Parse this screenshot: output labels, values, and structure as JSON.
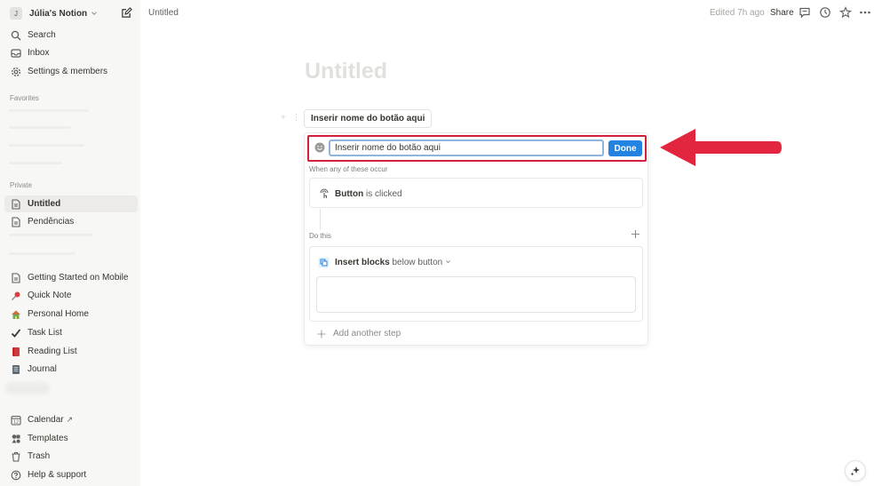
{
  "workspace": {
    "avatar_letter": "J",
    "name": "Júlia's Notion"
  },
  "sidebar": {
    "top_items": [
      {
        "label": "Search",
        "icon": "search-icon"
      },
      {
        "label": "Inbox",
        "icon": "inbox-icon"
      },
      {
        "label": "Settings & members",
        "icon": "gear-icon"
      }
    ],
    "favorites_label": "Favorites",
    "private_label": "Private",
    "private_items": [
      {
        "label": "Untitled",
        "icon": "page-icon",
        "active": true
      },
      {
        "label": "Pendências",
        "icon": "page-icon",
        "active": false
      }
    ],
    "pages": [
      {
        "label": "Getting Started on Mobile",
        "icon": "page-icon"
      },
      {
        "label": "Quick Note",
        "icon": "pin-icon"
      },
      {
        "label": "Personal Home",
        "icon": "home-icon"
      },
      {
        "label": "Task List",
        "icon": "checkmark-icon"
      },
      {
        "label": "Reading List",
        "icon": "book-icon"
      },
      {
        "label": "Journal",
        "icon": "notebook-icon"
      }
    ],
    "bottom_items": [
      {
        "label": "Calendar",
        "icon": "calendar-icon"
      },
      {
        "label": "Templates",
        "icon": "templates-icon"
      },
      {
        "label": "Trash",
        "icon": "trash-icon"
      },
      {
        "label": "Help & support",
        "icon": "help-icon"
      }
    ],
    "calendar_suffix": "↗"
  },
  "topbar": {
    "breadcrumb": "Untitled",
    "edited": "Edited 7h ago",
    "share": "Share"
  },
  "page": {
    "title": "Untitled",
    "button_label": "Inserir nome do botão aqui"
  },
  "editor": {
    "name_value": "Inserir nome do botão aqui",
    "done_label": "Done",
    "trigger_section": "When any of these occur",
    "trigger_bold": "Button",
    "trigger_rest": "is clicked",
    "action_section": "Do this",
    "action_bold": "Insert blocks",
    "action_rest": "below button",
    "add_step": "Add another step"
  },
  "colors": {
    "accent": "#2383e2",
    "annotation": "#d21f3c"
  }
}
